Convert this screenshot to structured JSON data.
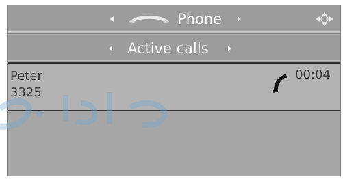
{
  "header": {
    "title": "Phone",
    "icons": {
      "left_arrow": "left-arrow-icon",
      "right_arrow": "right-arrow-icon",
      "handset": "handset-icon",
      "navigation": "four-way-arrows-icon"
    }
  },
  "submenu": {
    "title": "Active calls"
  },
  "active_call": {
    "name": "Peter",
    "number": "3325",
    "duration": "00:04",
    "status_icon": "phone-handset-icon"
  },
  "colors": {
    "screen_bg": "#a6a6a6",
    "bar_bg": "#9c9c9c",
    "selected_row_bg": "#b3b3b3",
    "header_text": "#f8f8f8",
    "row_text": "#3a3a3a",
    "watermark": "#6aa7d6"
  }
}
